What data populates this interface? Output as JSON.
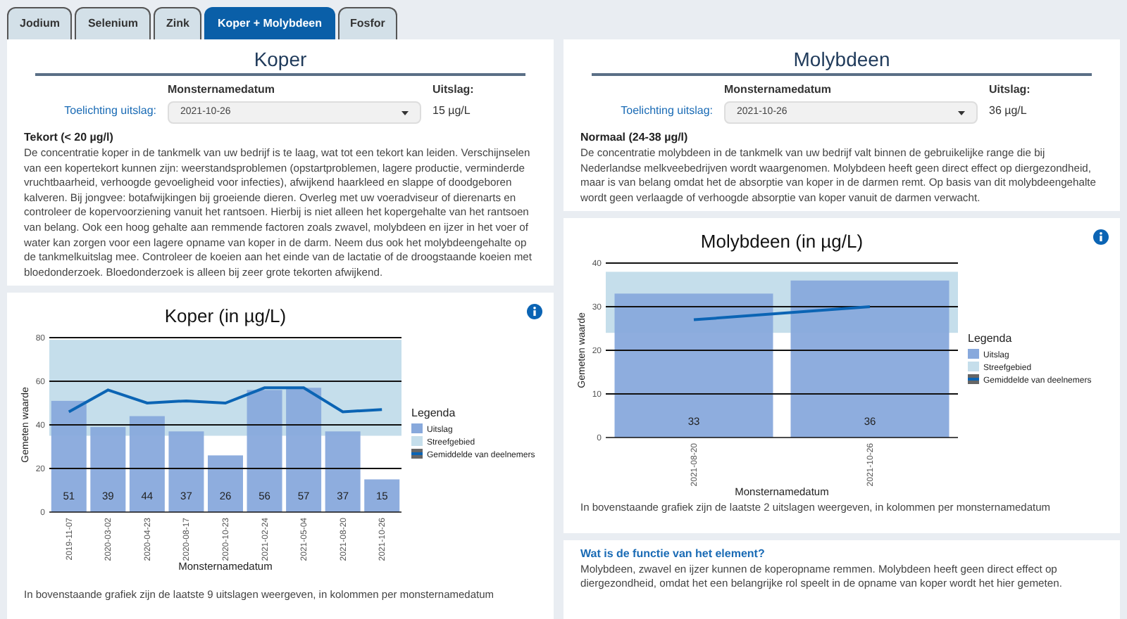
{
  "tabs": [
    {
      "label": "Jodium",
      "selected": false
    },
    {
      "label": "Selenium",
      "selected": false
    },
    {
      "label": "Zink",
      "selected": false
    },
    {
      "label": "Koper + Molybdeen",
      "selected": true
    },
    {
      "label": "Fosfor",
      "selected": false
    }
  ],
  "panels": [
    {
      "title": "Koper",
      "date_header": "Monsternamedatum",
      "result_header": "Uitslag:",
      "explanation_label": "Toelichting uitslag:",
      "date_select": {
        "value": "2021-10-26"
      },
      "result": "15 µg/L",
      "status_title": "Tekort (< 20 µg/l)",
      "status_text": "De concentratie koper in de tankmelk van uw bedrijf is te laag, wat tot een tekort kan leiden. Verschijnselen van een kopertekort kunnen zijn: weerstandsproblemen (opstartproblemen, lagere productie, verminderde vruchtbaarheid, verhoogde gevoeligheid voor infecties), afwijkend haarkleed en slappe of doodgeboren kalveren. Bij jongvee: botafwijkingen bij groeiende dieren. Overleg met uw voeradviseur of dierenarts en controleer de kopervoorziening vanuit het rantsoen. Hierbij is niet alleen het kopergehalte van het rantsoen van belang. Ook een hoog gehalte aan remmende factoren zoals zwavel, molybdeen en ijzer in het voer of water kan zorgen voor een lagere opname van koper in de darm. Neem dus ook het molybdeengehalte op de tankmelkuitslag mee. Controleer de koeien aan het einde van de lactatie of de droogstaande koeien met bloedonderzoek. Bloedonderzoek is alleen bij zeer grote tekorten afwijkend.",
      "chart_data": {
        "type": "bar",
        "title": "Koper (in µg/L)",
        "xlabel": "Monsternamedatum",
        "ylabel": "Gemeten waarde",
        "categories": [
          "2019-11-07",
          "2020-03-02",
          "2020-04-23",
          "2020-08-17",
          "2020-10-23",
          "2021-02-24",
          "2021-05-04",
          "2021-08-20",
          "2021-10-26"
        ],
        "series": [
          {
            "name": "Uitslag",
            "type": "bar",
            "color": "#88a9dc",
            "values": [
              51,
              39,
              44,
              37,
              26,
              56,
              57,
              37,
              15
            ]
          },
          {
            "name": "Gemiddelde van deelnemers",
            "type": "line",
            "color": "#0b64b4",
            "values": [
              46,
              56,
              50,
              51,
              50,
              57,
              57,
              46,
              47
            ]
          }
        ],
        "ylim": [
          0,
          80
        ],
        "yticks": [
          0,
          20,
          40,
          60,
          80
        ],
        "grid": true,
        "legend": {
          "title": "Legenda"
        },
        "value_labels": [
          "51",
          "39",
          "44",
          "37",
          "26",
          "56",
          "57",
          "37",
          "15"
        ],
        "bands": [
          {
            "label": "Streefgebied",
            "color": "#c5deeb",
            "axis": "y",
            "from": 35,
            "to": 79
          }
        ]
      },
      "chart_caption": "In bovenstaande grafiek zijn de laatste 9 uitslagen weergeven, in kolommen per monsternamedatum"
    },
    {
      "title": "Molybdeen",
      "date_header": "Monsternamedatum",
      "result_header": "Uitslag:",
      "explanation_label": "Toelichting uitslag:",
      "date_select": {
        "value": "2021-10-26"
      },
      "result": "36 µg/L",
      "status_title": "Normaal (24-38 µg/l)",
      "status_text": "De concentratie molybdeen in de tankmelk van uw bedrijf valt binnen de gebruikelijke range die bij Nederlandse melkveebedrijven wordt waargenomen. Molybdeen heeft geen direct effect op diergezondheid, maar is van belang omdat het de absorptie van koper in de darmen remt. Op basis van dit molybdeengehalte wordt geen verlaagde of verhoogde absorptie van koper vanuit de darmen verwacht.",
      "chart_data": {
        "type": "bar",
        "title": "Molybdeen (in µg/L)",
        "xlabel": "Monsternamedatum",
        "ylabel": "Gemeten waarde",
        "categories": [
          "2021-08-20",
          "2021-10-26"
        ],
        "series": [
          {
            "name": "Uitslag",
            "type": "bar",
            "color": "#88a9dc",
            "values": [
              33,
              36
            ]
          },
          {
            "name": "Gemiddelde van deelnemers",
            "type": "line",
            "color": "#0b64b4",
            "values": [
              27,
              30
            ]
          }
        ],
        "ylim": [
          0,
          40
        ],
        "yticks": [
          0,
          10,
          20,
          30,
          40
        ],
        "grid": true,
        "legend": {
          "title": "Legenda"
        },
        "value_labels": [
          "33",
          "36"
        ],
        "bands": [
          {
            "label": "Streefgebied",
            "color": "#c5deeb",
            "axis": "y",
            "from": 24,
            "to": 38
          }
        ]
      },
      "chart_caption": "In bovenstaande grafiek zijn de laatste 2 uitslagen weergeven, in kolommen per monsternamedatum"
    }
  ],
  "function_card": {
    "title": "Wat is de functie van het element?",
    "text": "Molybdeen, zwavel en ijzer kunnen de koperopname remmen. Molybdeen heeft geen direct effect op diergezondheid, omdat het een belangrijke rol speelt in de opname van koper wordt het hier gemeten."
  }
}
